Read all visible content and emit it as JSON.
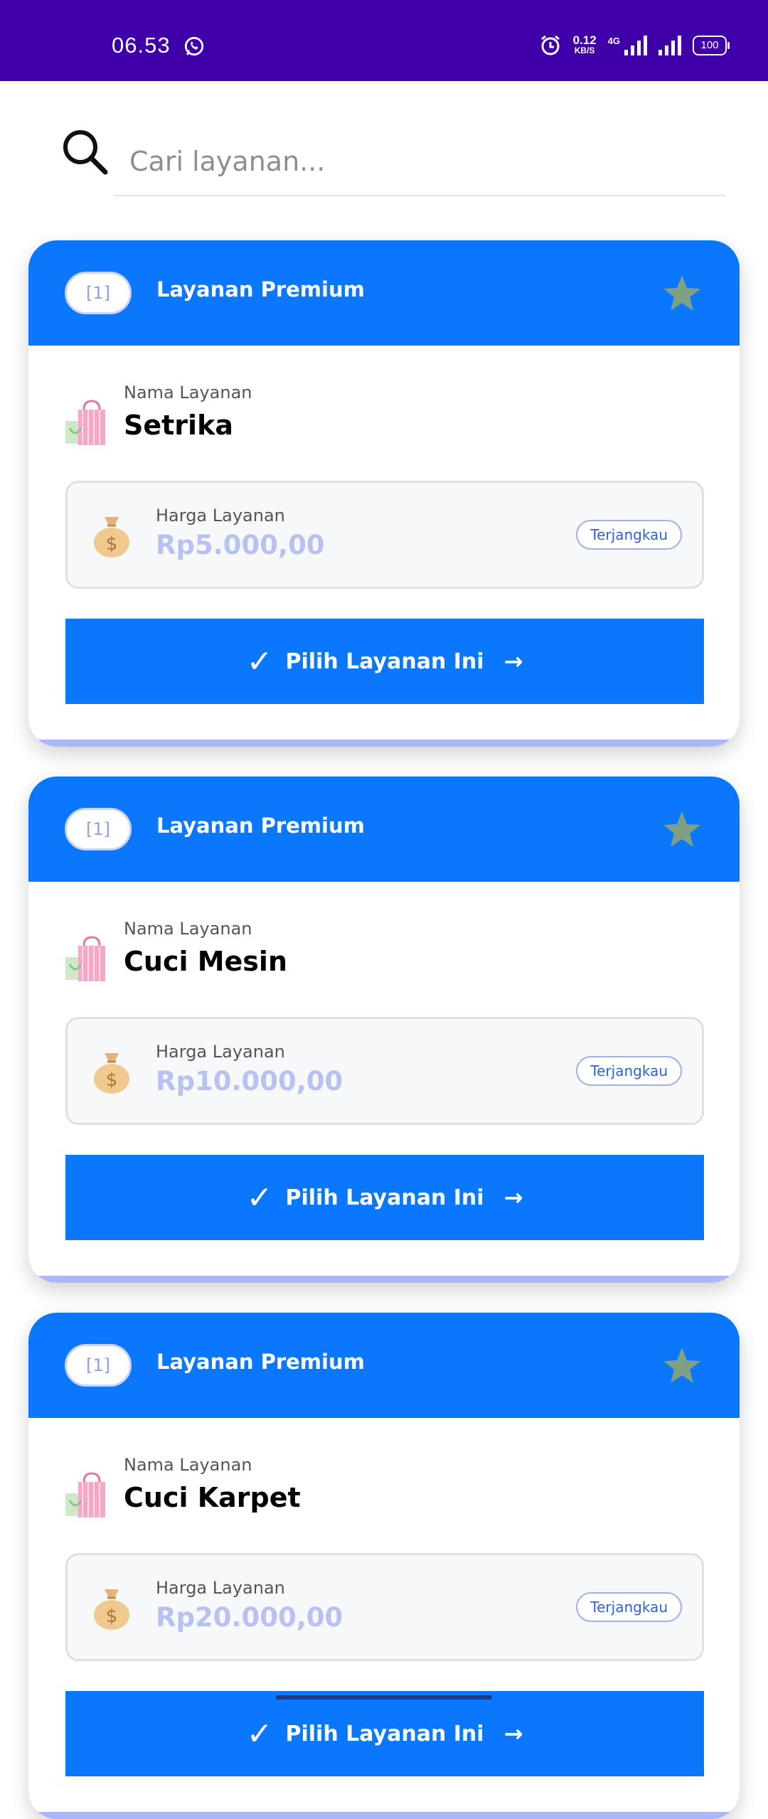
{
  "status_bar": {
    "time": "06.53",
    "net_speed_value": "0.12",
    "net_speed_unit": "KB/S",
    "network_type": "4G",
    "battery": "100",
    "icons": [
      "whatsapp-icon",
      "alarm-icon",
      "signal-icon",
      "battery-icon"
    ]
  },
  "search": {
    "placeholder": "Cari layanan...",
    "value": ""
  },
  "colors": {
    "status_bar": "#3f00aa",
    "primary": "#0a77fc",
    "accent": "#aab8f7",
    "price_text": "#b8c2f0",
    "star": "#7fa083"
  },
  "services": [
    {
      "badge": "[1]",
      "header_title": "Layanan Premium",
      "name_label": "Nama Layanan",
      "name": "Setrika",
      "price_label": "Harga Layanan",
      "price": "Rp5.000,00",
      "tag": "Terjangkau",
      "button_label": "Pilih Layanan Ini",
      "button_check": "✓",
      "button_arrow": "→"
    },
    {
      "badge": "[1]",
      "header_title": "Layanan Premium",
      "name_label": "Nama Layanan",
      "name": "Cuci Mesin",
      "price_label": "Harga Layanan",
      "price": "Rp10.000,00",
      "tag": "Terjangkau",
      "button_label": "Pilih Layanan Ini",
      "button_check": "✓",
      "button_arrow": "→"
    },
    {
      "badge": "[1]",
      "header_title": "Layanan Premium",
      "name_label": "Nama Layanan",
      "name": "Cuci Karpet",
      "price_label": "Harga Layanan",
      "price": "Rp20.000,00",
      "tag": "Terjangkau",
      "button_label": "Pilih Layanan Ini",
      "button_check": "✓",
      "button_arrow": "→"
    }
  ]
}
